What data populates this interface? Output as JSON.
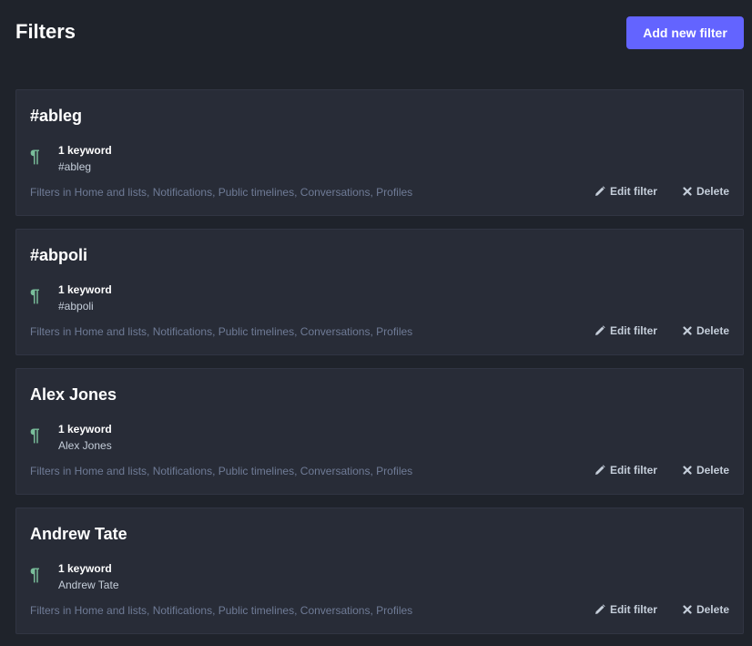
{
  "header": {
    "title": "Filters",
    "add_button_label": "Add new filter",
    "accent_color": "#6364ff"
  },
  "filters": [
    {
      "title": "#ableg",
      "keyword_count": "1 keyword",
      "keyword": "#ableg",
      "context": "Filters in Home and lists, Notifications, Public timelines, Conversations, Profiles",
      "edit_label": "Edit filter",
      "delete_label": "Delete"
    },
    {
      "title": "#abpoli",
      "keyword_count": "1 keyword",
      "keyword": "#abpoli",
      "context": "Filters in Home and lists, Notifications, Public timelines, Conversations, Profiles",
      "edit_label": "Edit filter",
      "delete_label": "Delete"
    },
    {
      "title": "Alex Jones",
      "keyword_count": "1 keyword",
      "keyword": "Alex Jones",
      "context": "Filters in Home and lists, Notifications, Public timelines, Conversations, Profiles",
      "edit_label": "Edit filter",
      "delete_label": "Delete"
    },
    {
      "title": "Andrew Tate",
      "keyword_count": "1 keyword",
      "keyword": "Andrew Tate",
      "context": "Filters in Home and lists, Notifications, Public timelines, Conversations, Profiles",
      "edit_label": "Edit filter",
      "delete_label": "Delete"
    }
  ],
  "icons": {
    "keyword": "paragraph-icon",
    "edit": "pencil-icon",
    "delete": "close-icon",
    "keyword_color": "#79bd9a"
  }
}
